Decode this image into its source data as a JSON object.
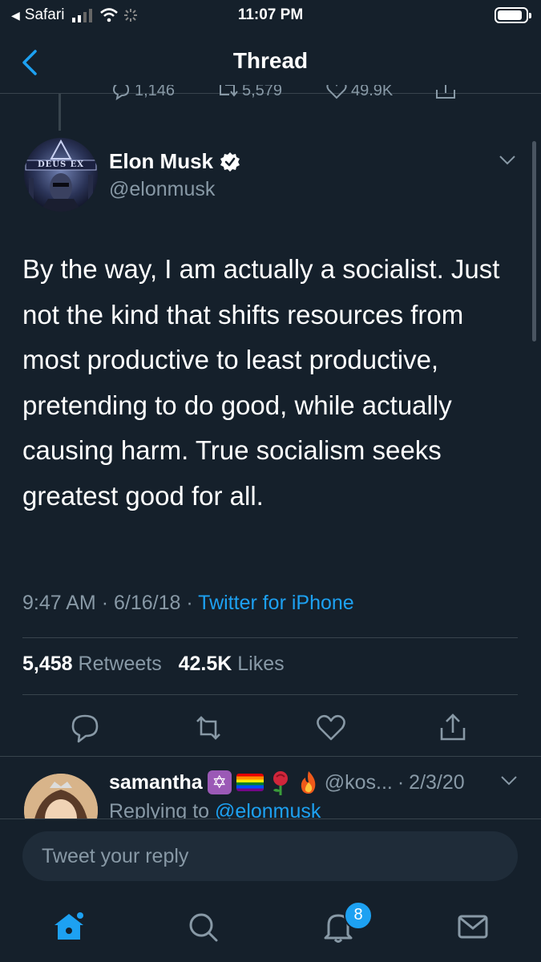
{
  "status_bar": {
    "back_app": "Safari",
    "time": "11:07 PM"
  },
  "header": {
    "title": "Thread"
  },
  "previous_tweet": {
    "replies": "1,146",
    "retweets": "5,579",
    "likes": "49.9K"
  },
  "tweet": {
    "author_name": "Elon Musk",
    "author_handle": "@elonmusk",
    "avatar_text": "DEUS EX",
    "text": "By the way, I am actually a socialist. Just not the kind that shifts resources from most productive to least productive, pretending to do good, while actually causing harm. True socialism seeks greatest good for all.",
    "time": "9:47 AM",
    "date": "6/16/18",
    "source": "Twitter for iPhone",
    "retweet_count": "5,458",
    "retweet_label": "Retweets",
    "like_count": "42.5K",
    "like_label": "Likes"
  },
  "reply": {
    "author_name": "samantha",
    "handle_truncated": "@kos...",
    "date": "2/3/20",
    "replying_prefix": "Replying to",
    "replying_to": "@elonmusk"
  },
  "compose": {
    "placeholder": "Tweet your reply"
  },
  "tab_bar": {
    "notifications_badge": "8"
  },
  "colors": {
    "background": "#15202b",
    "accent": "#1da1f2",
    "muted_text": "#8899a6",
    "divider": "#38444d"
  }
}
